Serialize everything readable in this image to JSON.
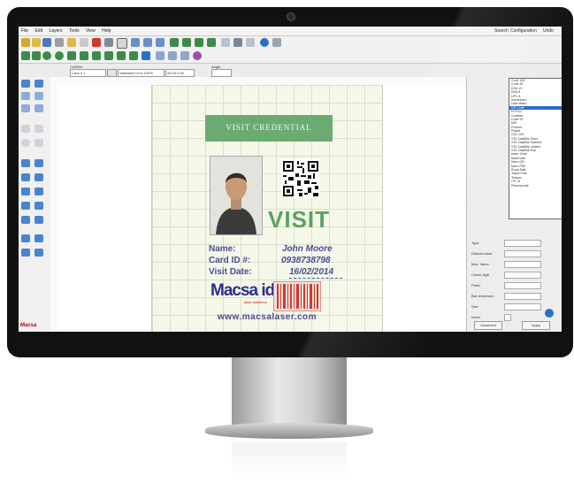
{
  "app": {
    "menu": [
      "File",
      "Edit",
      "Layers",
      "Tools",
      "View",
      "Help"
    ],
    "menu_right": [
      "Search",
      "Configuration",
      "Undo"
    ],
    "brand": "Macsa"
  },
  "propbar": {
    "cell_label": "Cell/Ref",
    "name_value": "Cara 4 1",
    "position_value": "Standard 0.0 #-100%",
    "size_value": "00.00 0.00",
    "unit_label": "Angle"
  },
  "card": {
    "header": "VISIT CREDENTIAL",
    "visit": "VISIT",
    "name_label": "Name:",
    "name_value": "John Moore",
    "card_label": "Card ID #:",
    "card_value": "0938738798",
    "date_label": "Visit Date:",
    "date_value": "16/02/2014",
    "logo": "Macsa id",
    "logo_sub": "laser solutions",
    "url": "www.macsalaser.com"
  },
  "panel": {
    "dropdown_items": [
      "Code 128",
      "Code 39",
      "EAN 13",
      "EAN 8",
      "UPC A",
      "Interleaved",
      "Data Matrix",
      "QR Code",
      "PDF417",
      "Codabar",
      "Code 93",
      "MSI",
      "Postnet",
      "Planet",
      "GS1 128",
      "GS1 DataBar Omni",
      "GS1 DataBar Stacked",
      "GS1 DataBar Limited",
      "GS1 DataBar Exp",
      "Aztec Code",
      "MaxiCode",
      "Micro QR",
      "Micro PDF",
      "Royal Mail",
      "Japan Post",
      "Telepen",
      "ITF 14",
      "Pharmacode"
    ],
    "selected_index": 7,
    "fields": [
      "Type",
      "Default value",
      "Max. Value",
      "Check digit",
      "Prefix",
      "Bar dimension",
      "Size",
      "Invert"
    ],
    "ok": "Advanced",
    "cancel": "Apply"
  },
  "colors": {
    "header_green": "#6bab72",
    "visit_green": "#5aa35d",
    "text_blue": "#4a4a9a",
    "brand_red": "#cc0000"
  }
}
